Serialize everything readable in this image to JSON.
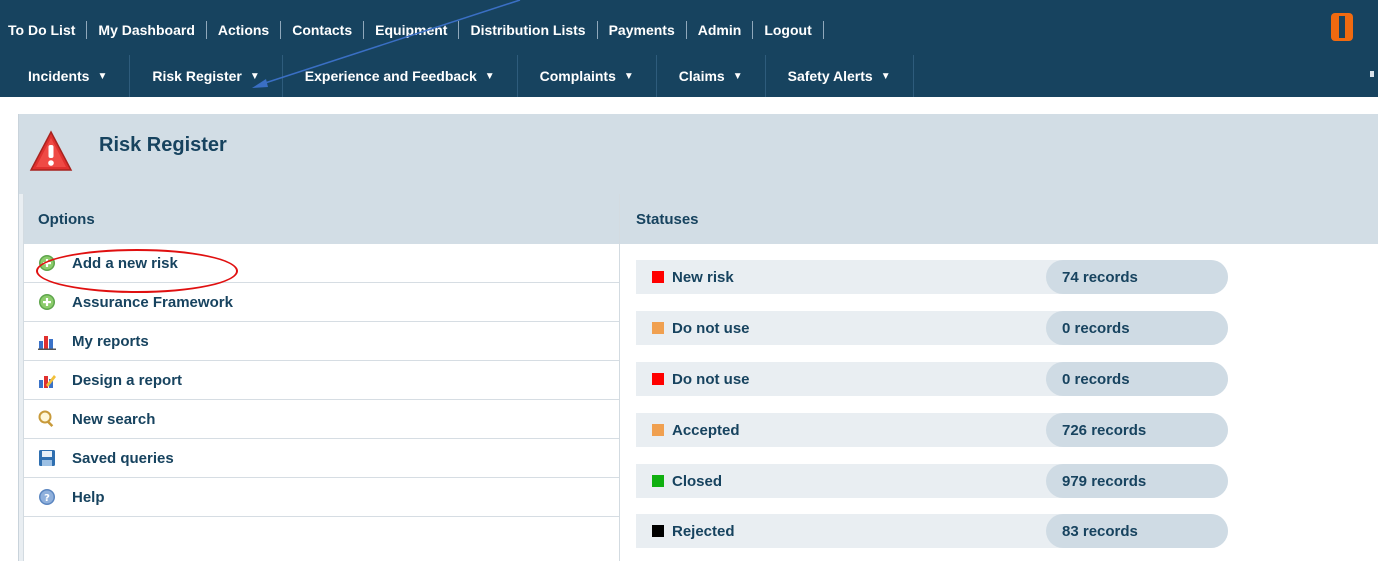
{
  "top_nav": [
    "To Do List",
    "My Dashboard",
    "Actions",
    "Contacts",
    "Equipment",
    "Distribution Lists",
    "Payments",
    "Admin",
    "Logout"
  ],
  "module_nav": [
    "Incidents",
    "Risk Register",
    "Experience and Feedback",
    "Complaints",
    "Claims",
    "Safety Alerts"
  ],
  "colors": {
    "brand": "#17435f",
    "accent": "#f06a10",
    "highlight_circle": "#e01010"
  },
  "page": {
    "title": "Risk Register",
    "icon": "warning-triangle-icon"
  },
  "options": {
    "heading": "Options",
    "items": [
      {
        "label": "Add a new risk",
        "icon": "add-circle-icon"
      },
      {
        "label": "Assurance Framework",
        "icon": "add-circle-icon"
      },
      {
        "label": "My reports",
        "icon": "bar-chart-icon"
      },
      {
        "label": "Design a report",
        "icon": "chart-pencil-icon"
      },
      {
        "label": "New search",
        "icon": "magnifier-icon"
      },
      {
        "label": "Saved queries",
        "icon": "floppy-disk-icon"
      },
      {
        "label": "Help",
        "icon": "help-icon"
      }
    ]
  },
  "statuses": {
    "heading": "Statuses",
    "items": [
      {
        "label": "New risk",
        "count": "74 records",
        "color": "#ff0000"
      },
      {
        "label": "Do not use",
        "count": "0 records",
        "color": "#f0a050"
      },
      {
        "label": "Do not use",
        "count": "0 records",
        "color": "#ff0000"
      },
      {
        "label": "Accepted",
        "count": "726 records",
        "color": "#f0a050"
      },
      {
        "label": "Closed",
        "count": "979 records",
        "color": "#10b010"
      },
      {
        "label": "Rejected",
        "count": "83 records",
        "color": "#000000"
      }
    ]
  }
}
